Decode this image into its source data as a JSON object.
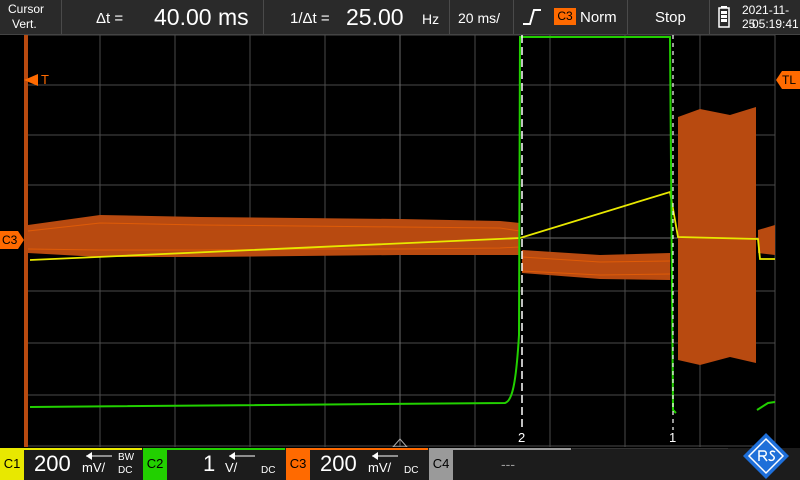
{
  "toolbar": {
    "mode_line1": "Cursor",
    "mode_line2": "Vert.",
    "delta_t_label": "Δt =",
    "delta_t_value": "40.00 ms",
    "inv_delta_t_label": "1/Δt =",
    "inv_delta_t_value": "25.00",
    "inv_delta_t_unit": "Hz",
    "timebase": "20 ms/",
    "trigger_source": "C3",
    "trigger_mode": "Norm",
    "run_state": "Stop",
    "date": "2021-11-25",
    "time": "05:19:41"
  },
  "markers": {
    "trigger": "T",
    "trigger_level": "TL",
    "channel3": "C3",
    "cursor_2": "2",
    "cursor_1": "1"
  },
  "channels": [
    {
      "tag": "C1",
      "value": "200",
      "unit": "mV/",
      "bw": "BW",
      "coupling": "DC",
      "color": "#e8e800"
    },
    {
      "tag": "C2",
      "value": "1",
      "unit": "V/",
      "bw": "",
      "coupling": "DC",
      "color": "#22d000"
    },
    {
      "tag": "C3",
      "value": "200",
      "unit": "mV/",
      "bw": "",
      "coupling": "DC",
      "color": "#ff6a00"
    },
    {
      "tag": "C4",
      "value": "---",
      "unit": "",
      "bw": "",
      "coupling": "",
      "color": "#9a9a9a"
    }
  ],
  "colors": {
    "c1": "#e8e800",
    "c2": "#22d000",
    "c3": "#ff6a00",
    "background": "#000000",
    "brand": "#1e6fd9"
  },
  "icons": {
    "battery": "battery-icon",
    "rising_edge": "rising-edge-icon",
    "brand": "rs-logo-icon"
  }
}
